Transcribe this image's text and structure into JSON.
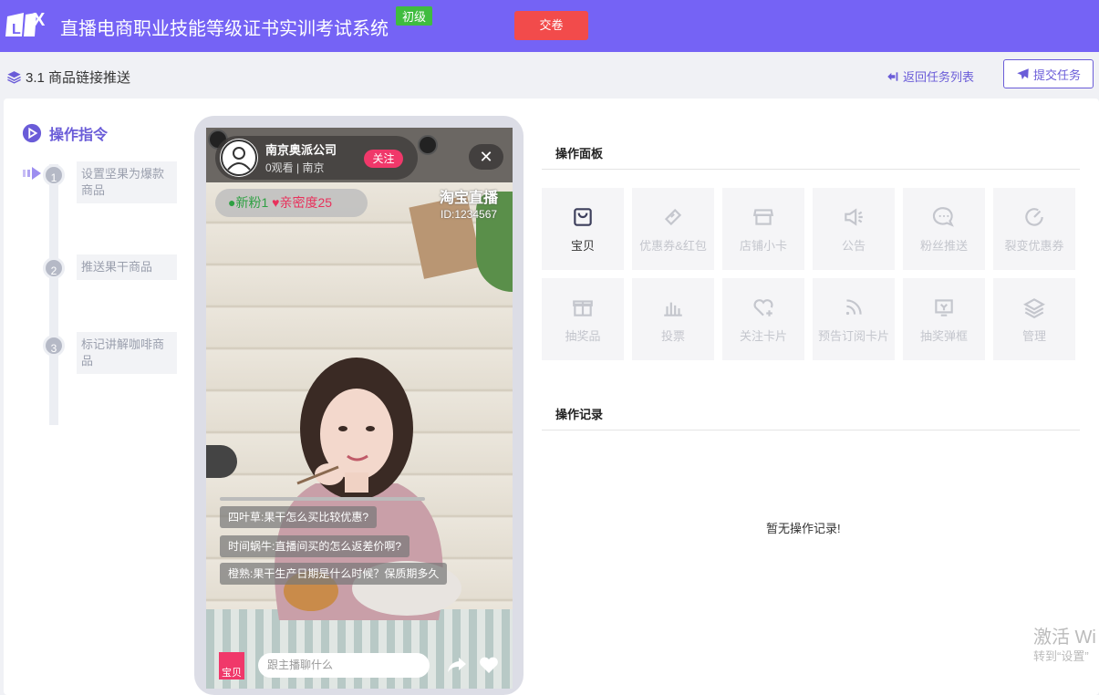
{
  "header": {
    "logo_text": "LX",
    "title": "直播电商职业技能等级证书实训考试系统",
    "level_badge": "初级",
    "submit_exam_label": "交卷"
  },
  "subheader": {
    "task_title": "3.1 商品链接推送",
    "back_link": "返回任务列表",
    "submit_task": "提交任务"
  },
  "instructions": {
    "heading": "操作指令",
    "steps": [
      {
        "num": "1",
        "text": "设置坚果为爆款商品"
      },
      {
        "num": "2",
        "text": "推送果干商品"
      },
      {
        "num": "3",
        "text": "标记讲解咖啡商品"
      }
    ]
  },
  "live": {
    "host_name": "南京奥派公司",
    "host_meta": "0观看 | 南京",
    "follow": "关注",
    "close": "✕",
    "fans": "新粉1",
    "intimacy": "亲密度25",
    "brand": "淘宝直播",
    "room_id": "ID:1234567",
    "comments": [
      "四叶草:果干怎么买比较优惠?",
      "时间蜗牛:直播间买的怎么返差价啊?",
      "橙熟:果干生产日期是什么时候？保质期多久"
    ],
    "product_badge": "宝贝",
    "chat_placeholder": "跟主播聊什么"
  },
  "ops_panel": {
    "title": "操作面板",
    "tiles": [
      {
        "label": "宝贝",
        "icon": "shopping-bag-icon",
        "active": true
      },
      {
        "label": "优惠券&红包",
        "icon": "coupon-icon",
        "active": false
      },
      {
        "label": "店铺小卡",
        "icon": "store-icon",
        "active": false
      },
      {
        "label": "公告",
        "icon": "megaphone-icon",
        "active": false
      },
      {
        "label": "粉丝推送",
        "icon": "chat-bubble-icon",
        "active": false
      },
      {
        "label": "裂变优惠券",
        "icon": "gauge-icon",
        "active": false
      },
      {
        "label": "抽奖品",
        "icon": "gift-icon",
        "active": false
      },
      {
        "label": "投票",
        "icon": "bar-chart-icon",
        "active": false
      },
      {
        "label": "关注卡片",
        "icon": "heart-plus-icon",
        "active": false
      },
      {
        "label": "预告订阅卡片",
        "icon": "rss-icon",
        "active": false
      },
      {
        "label": "抽奖弹框",
        "icon": "lottery-box-icon",
        "active": false
      },
      {
        "label": "管理",
        "icon": "layers-icon",
        "active": false
      }
    ]
  },
  "ops_log": {
    "title": "操作记录",
    "empty_text": "暂无操作记录!"
  },
  "watermark": {
    "line1": "激活 Wi",
    "line2": "转到“设置”"
  },
  "colors": {
    "brand_purple": "#7563f5",
    "accent_purple": "#6a5cd8",
    "danger_red": "#f24b4b",
    "badge_green": "#3fbc3f",
    "pink": "#f0386a"
  }
}
